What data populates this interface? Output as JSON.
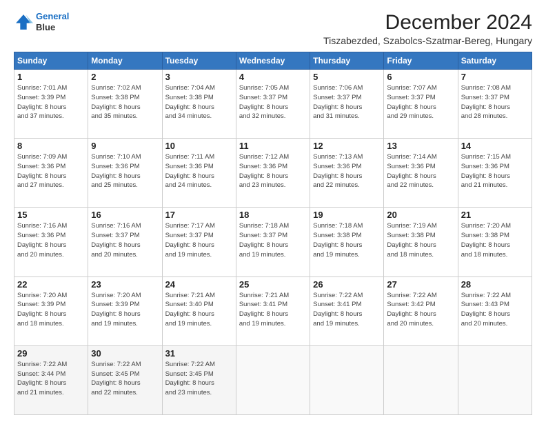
{
  "header": {
    "logo_line1": "General",
    "logo_line2": "Blue",
    "title": "December 2024",
    "subtitle": "Tiszabezded, Szabolcs-Szatmar-Bereg, Hungary"
  },
  "weekdays": [
    "Sunday",
    "Monday",
    "Tuesday",
    "Wednesday",
    "Thursday",
    "Friday",
    "Saturday"
  ],
  "weeks": [
    [
      {
        "day": "1",
        "info": "Sunrise: 7:01 AM\nSunset: 3:39 PM\nDaylight: 8 hours\nand 37 minutes."
      },
      {
        "day": "2",
        "info": "Sunrise: 7:02 AM\nSunset: 3:38 PM\nDaylight: 8 hours\nand 35 minutes."
      },
      {
        "day": "3",
        "info": "Sunrise: 7:04 AM\nSunset: 3:38 PM\nDaylight: 8 hours\nand 34 minutes."
      },
      {
        "day": "4",
        "info": "Sunrise: 7:05 AM\nSunset: 3:37 PM\nDaylight: 8 hours\nand 32 minutes."
      },
      {
        "day": "5",
        "info": "Sunrise: 7:06 AM\nSunset: 3:37 PM\nDaylight: 8 hours\nand 31 minutes."
      },
      {
        "day": "6",
        "info": "Sunrise: 7:07 AM\nSunset: 3:37 PM\nDaylight: 8 hours\nand 29 minutes."
      },
      {
        "day": "7",
        "info": "Sunrise: 7:08 AM\nSunset: 3:37 PM\nDaylight: 8 hours\nand 28 minutes."
      }
    ],
    [
      {
        "day": "8",
        "info": "Sunrise: 7:09 AM\nSunset: 3:36 PM\nDaylight: 8 hours\nand 27 minutes."
      },
      {
        "day": "9",
        "info": "Sunrise: 7:10 AM\nSunset: 3:36 PM\nDaylight: 8 hours\nand 25 minutes."
      },
      {
        "day": "10",
        "info": "Sunrise: 7:11 AM\nSunset: 3:36 PM\nDaylight: 8 hours\nand 24 minutes."
      },
      {
        "day": "11",
        "info": "Sunrise: 7:12 AM\nSunset: 3:36 PM\nDaylight: 8 hours\nand 23 minutes."
      },
      {
        "day": "12",
        "info": "Sunrise: 7:13 AM\nSunset: 3:36 PM\nDaylight: 8 hours\nand 22 minutes."
      },
      {
        "day": "13",
        "info": "Sunrise: 7:14 AM\nSunset: 3:36 PM\nDaylight: 8 hours\nand 22 minutes."
      },
      {
        "day": "14",
        "info": "Sunrise: 7:15 AM\nSunset: 3:36 PM\nDaylight: 8 hours\nand 21 minutes."
      }
    ],
    [
      {
        "day": "15",
        "info": "Sunrise: 7:16 AM\nSunset: 3:36 PM\nDaylight: 8 hours\nand 20 minutes."
      },
      {
        "day": "16",
        "info": "Sunrise: 7:16 AM\nSunset: 3:37 PM\nDaylight: 8 hours\nand 20 minutes."
      },
      {
        "day": "17",
        "info": "Sunrise: 7:17 AM\nSunset: 3:37 PM\nDaylight: 8 hours\nand 19 minutes."
      },
      {
        "day": "18",
        "info": "Sunrise: 7:18 AM\nSunset: 3:37 PM\nDaylight: 8 hours\nand 19 minutes."
      },
      {
        "day": "19",
        "info": "Sunrise: 7:18 AM\nSunset: 3:38 PM\nDaylight: 8 hours\nand 19 minutes."
      },
      {
        "day": "20",
        "info": "Sunrise: 7:19 AM\nSunset: 3:38 PM\nDaylight: 8 hours\nand 18 minutes."
      },
      {
        "day": "21",
        "info": "Sunrise: 7:20 AM\nSunset: 3:38 PM\nDaylight: 8 hours\nand 18 minutes."
      }
    ],
    [
      {
        "day": "22",
        "info": "Sunrise: 7:20 AM\nSunset: 3:39 PM\nDaylight: 8 hours\nand 18 minutes."
      },
      {
        "day": "23",
        "info": "Sunrise: 7:20 AM\nSunset: 3:39 PM\nDaylight: 8 hours\nand 19 minutes."
      },
      {
        "day": "24",
        "info": "Sunrise: 7:21 AM\nSunset: 3:40 PM\nDaylight: 8 hours\nand 19 minutes."
      },
      {
        "day": "25",
        "info": "Sunrise: 7:21 AM\nSunset: 3:41 PM\nDaylight: 8 hours\nand 19 minutes."
      },
      {
        "day": "26",
        "info": "Sunrise: 7:22 AM\nSunset: 3:41 PM\nDaylight: 8 hours\nand 19 minutes."
      },
      {
        "day": "27",
        "info": "Sunrise: 7:22 AM\nSunset: 3:42 PM\nDaylight: 8 hours\nand 20 minutes."
      },
      {
        "day": "28",
        "info": "Sunrise: 7:22 AM\nSunset: 3:43 PM\nDaylight: 8 hours\nand 20 minutes."
      }
    ],
    [
      {
        "day": "29",
        "info": "Sunrise: 7:22 AM\nSunset: 3:44 PM\nDaylight: 8 hours\nand 21 minutes."
      },
      {
        "day": "30",
        "info": "Sunrise: 7:22 AM\nSunset: 3:45 PM\nDaylight: 8 hours\nand 22 minutes."
      },
      {
        "day": "31",
        "info": "Sunrise: 7:22 AM\nSunset: 3:45 PM\nDaylight: 8 hours\nand 23 minutes."
      },
      null,
      null,
      null,
      null
    ]
  ]
}
